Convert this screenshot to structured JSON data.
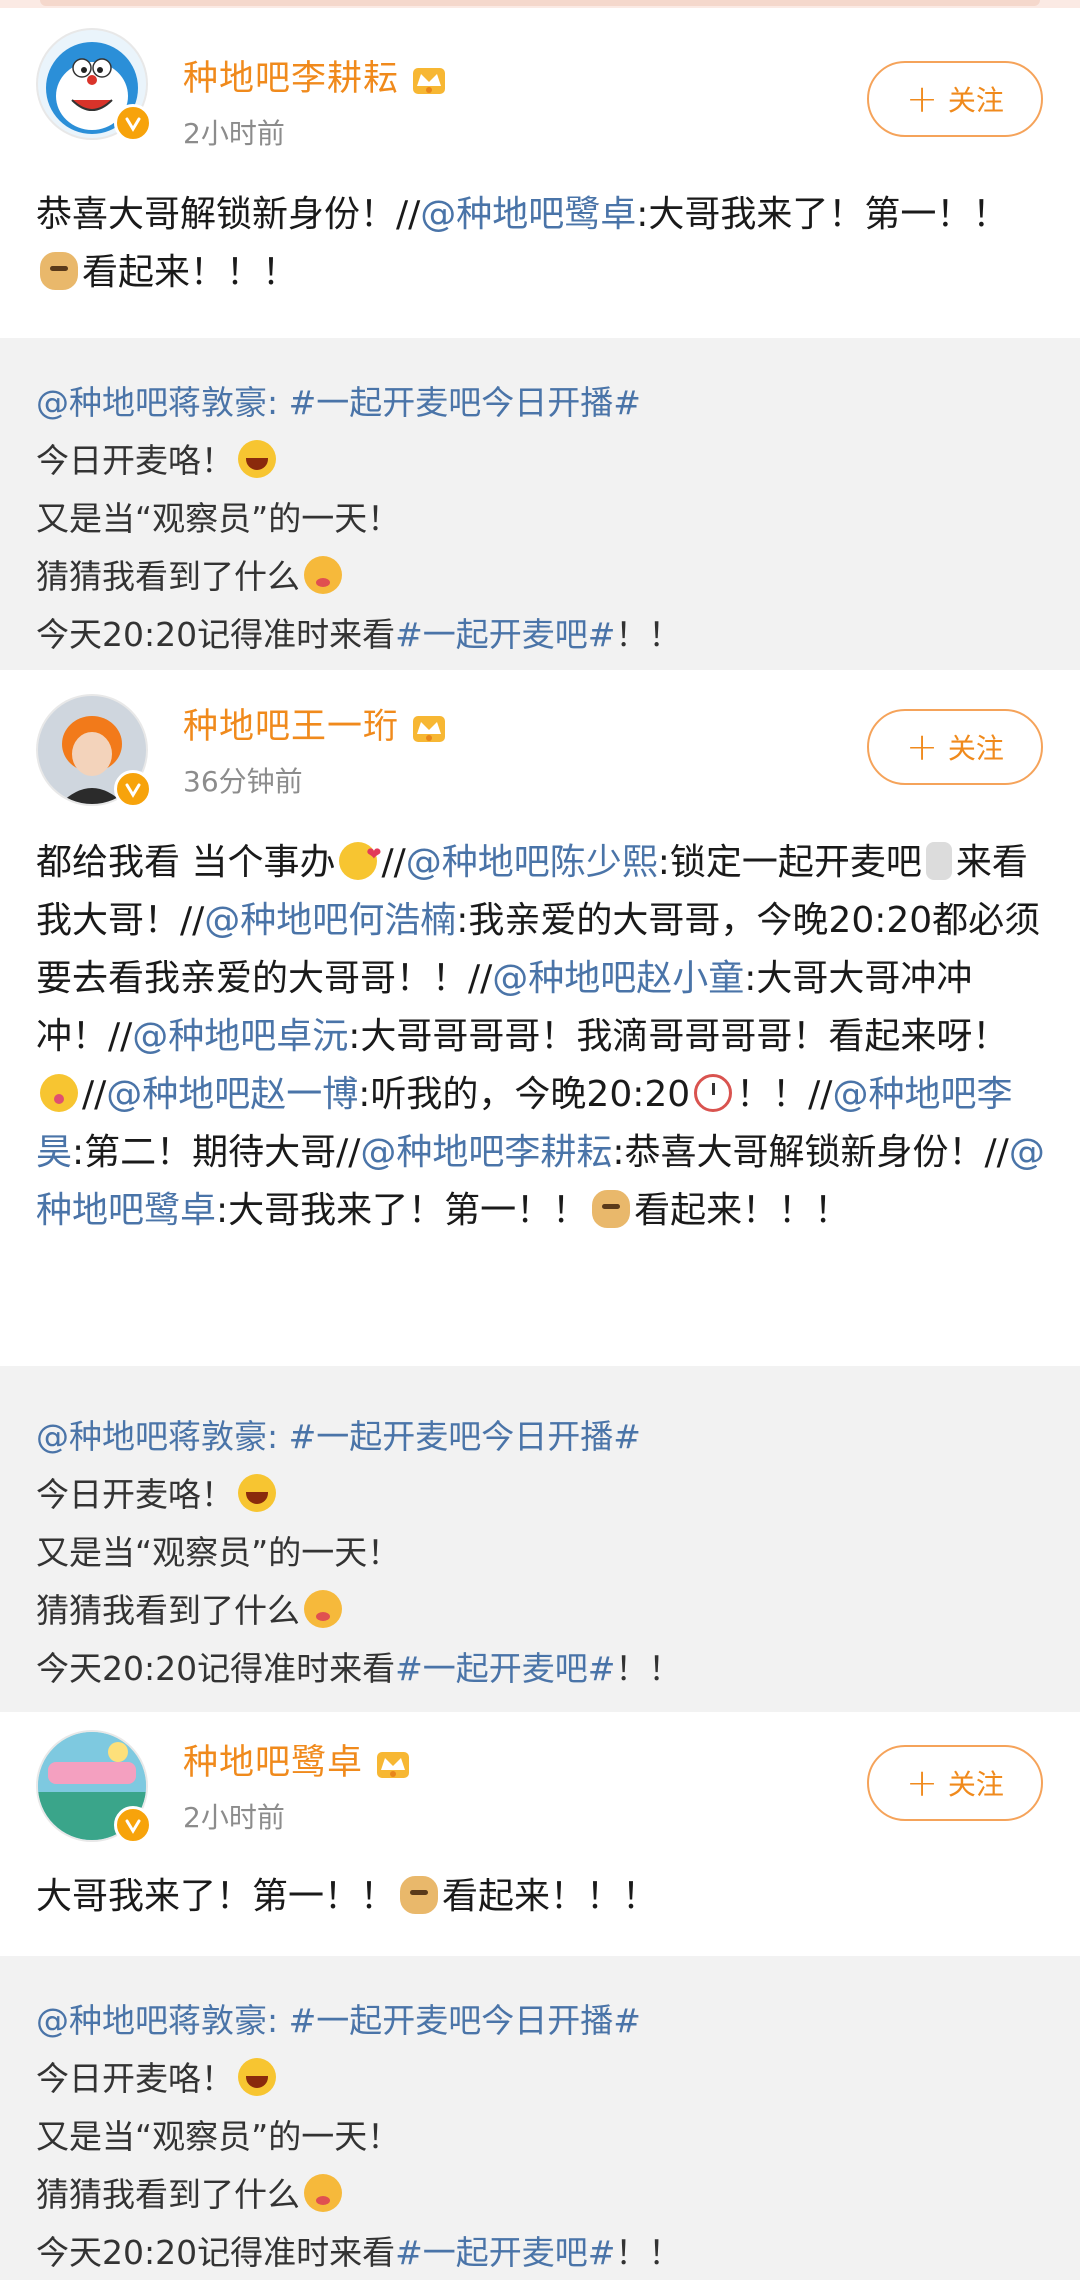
{
  "follow_label": "关注",
  "posts": [
    {
      "username": "种地吧李耕耘",
      "time": "2小时前",
      "body": [
        {
          "t": "恭喜大哥解锁新身份！//"
        },
        {
          "t": "@种地吧鹭卓",
          "m": true
        },
        {
          "t": ":大哥我来了！第一！！"
        },
        {
          "e": "doge-emoji"
        },
        {
          "t": "看起来！！！"
        }
      ]
    },
    {
      "username": "种地吧王一珩",
      "time": "36分钟前",
      "body": [
        {
          "t": "都给我看 当个事办"
        },
        {
          "e": "heart-emoji"
        },
        {
          "t": "//"
        },
        {
          "t": "@种地吧陈少熙",
          "m": true
        },
        {
          "t": ":锁定一起开麦吧"
        },
        {
          "e": "mic-emoji"
        },
        {
          "t": "来看我大哥！//"
        },
        {
          "t": "@种地吧何浩楠",
          "m": true
        },
        {
          "t": ":我亲爱的大哥哥，今晚20:20都必须要去看我亲爱的大哥哥！！//"
        },
        {
          "t": "@种地吧赵小童",
          "m": true
        },
        {
          "t": ":大哥大哥冲冲冲！//"
        },
        {
          "t": "@种地吧卓沅",
          "m": true
        },
        {
          "t": ":大哥哥哥哥！我滴哥哥哥哥！看起来呀！"
        },
        {
          "e": "kiss-emoji"
        },
        {
          "t": "//"
        },
        {
          "t": "@种地吧赵一博",
          "m": true
        },
        {
          "t": ":听我的，今晚20:20"
        },
        {
          "e": "clock-emoji"
        },
        {
          "t": "！！//"
        },
        {
          "t": "@种地吧李昊",
          "m": true
        },
        {
          "t": ":第二！期待大哥//"
        },
        {
          "t": "@种地吧李耕耘",
          "m": true
        },
        {
          "t": ":恭喜大哥解锁新身份！//"
        },
        {
          "t": "@种地吧鹭卓",
          "m": true
        },
        {
          "t": ":大哥我来了！第一！！"
        },
        {
          "e": "doge-emoji"
        },
        {
          "t": "看起来！！！"
        }
      ]
    },
    {
      "username": "种地吧鹭卓",
      "time": "2小时前",
      "body": [
        {
          "t": "大哥我来了！第一！！"
        },
        {
          "e": "doge-emoji"
        },
        {
          "t": "看起来！！！"
        }
      ]
    }
  ],
  "repost": {
    "author": "@种地吧蒋敦豪",
    "topic": "#一起开麦吧今日开播#",
    "line1": "今日开麦咯！",
    "line2": "又是当“观察员”的一天！",
    "line3": "猜猜我看到了什么",
    "line4_prefix": "今天20:20记得准时来看",
    "line4_topic": "#一起开麦吧#",
    "line4_suffix": "！！"
  }
}
